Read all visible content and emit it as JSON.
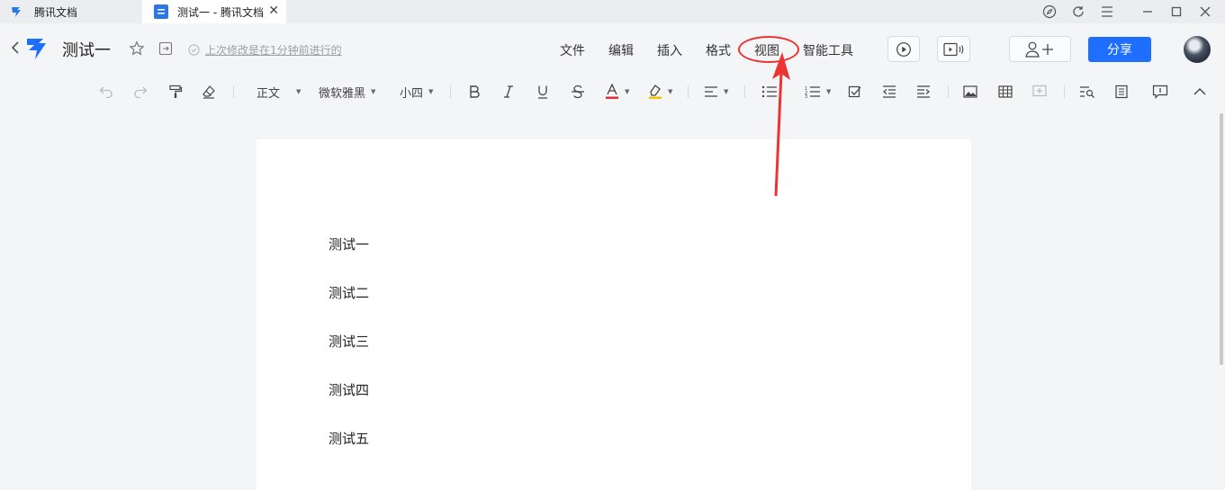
{
  "tabs": [
    {
      "label": "腾讯文档"
    },
    {
      "label": "测试一 - 腾讯文档"
    }
  ],
  "window_controls": [
    "compass-icon",
    "refresh-icon",
    "menu-icon",
    "minimize-icon",
    "maximize-icon",
    "close-icon"
  ],
  "header": {
    "title": "测试一",
    "save_status": "上次修改是在1分钟前进行的",
    "menu": [
      "文件",
      "编辑",
      "插入",
      "格式",
      "视图",
      "智能工具"
    ],
    "share_label": "分享"
  },
  "toolbar": {
    "style": "正文",
    "font": "微软雅黑",
    "size": "小四"
  },
  "document": {
    "paragraphs": [
      "测试一",
      "测试二",
      "测试三",
      "测试四",
      "测试五"
    ]
  },
  "annotation": {
    "highlight_color": "#e33333",
    "highlighted_item": "视图"
  },
  "colors": {
    "accent": "#1e6fff",
    "font_color_underline": "#e03030",
    "highlight_underline": "#f5c400"
  }
}
